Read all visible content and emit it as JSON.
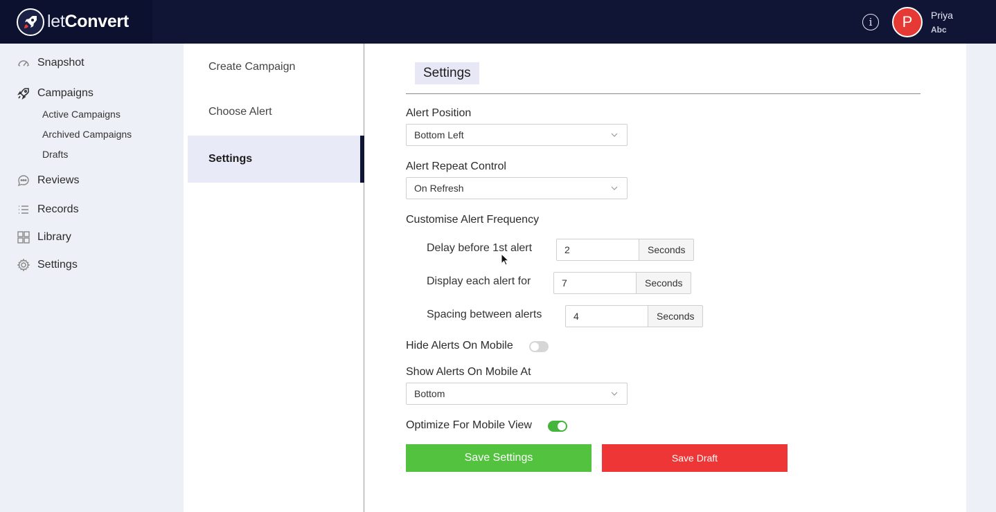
{
  "header": {
    "logo_light": "let",
    "logo_bold": "Convert",
    "user_name": "Priya",
    "user_sub": "Abc",
    "avatar_initial": "P"
  },
  "sidebar": {
    "items": [
      {
        "label": "Snapshot",
        "icon": "gauge-icon"
      },
      {
        "label": "Campaigns",
        "icon": "rocket-icon"
      },
      {
        "label": "Reviews",
        "icon": "chat-bubble-icon"
      },
      {
        "label": "Records",
        "icon": "list-icon"
      },
      {
        "label": "Library",
        "icon": "grid-icon"
      },
      {
        "label": "Settings",
        "icon": "gear-icon"
      }
    ],
    "campaign_subitems": [
      "Active Campaigns",
      "Archived Campaigns",
      "Drafts"
    ]
  },
  "steps": [
    "Create Campaign",
    "Choose Alert",
    "Settings"
  ],
  "active_step": "Settings",
  "main": {
    "title": "Settings",
    "alert_position": {
      "label": "Alert Position",
      "value": "Bottom Left"
    },
    "alert_repeat": {
      "label": "Alert Repeat Control",
      "value": "On Refresh"
    },
    "frequency": {
      "label": "Customise Alert Frequency",
      "rows": [
        {
          "label": "Delay before 1st alert",
          "value": "2",
          "unit": "Seconds"
        },
        {
          "label": "Display each alert for",
          "value": "7",
          "unit": "Seconds"
        },
        {
          "label": "Spacing between alerts",
          "value": "4",
          "unit": "Seconds"
        }
      ]
    },
    "hide_mobile": {
      "label": "Hide Alerts On Mobile",
      "enabled": false
    },
    "show_mobile_at": {
      "label": "Show Alerts On Mobile At",
      "value": "Bottom"
    },
    "optimize_mobile": {
      "label": "Optimize For Mobile View",
      "enabled": true
    },
    "save_settings_label": "Save Settings",
    "save_draft_label": "Save Draft"
  },
  "colors": {
    "topbar": "#101536",
    "accent_green": "#52c23f",
    "accent_red": "#ee3636",
    "active_step_bg": "#e9eaf7",
    "avatar": "#e53935"
  }
}
